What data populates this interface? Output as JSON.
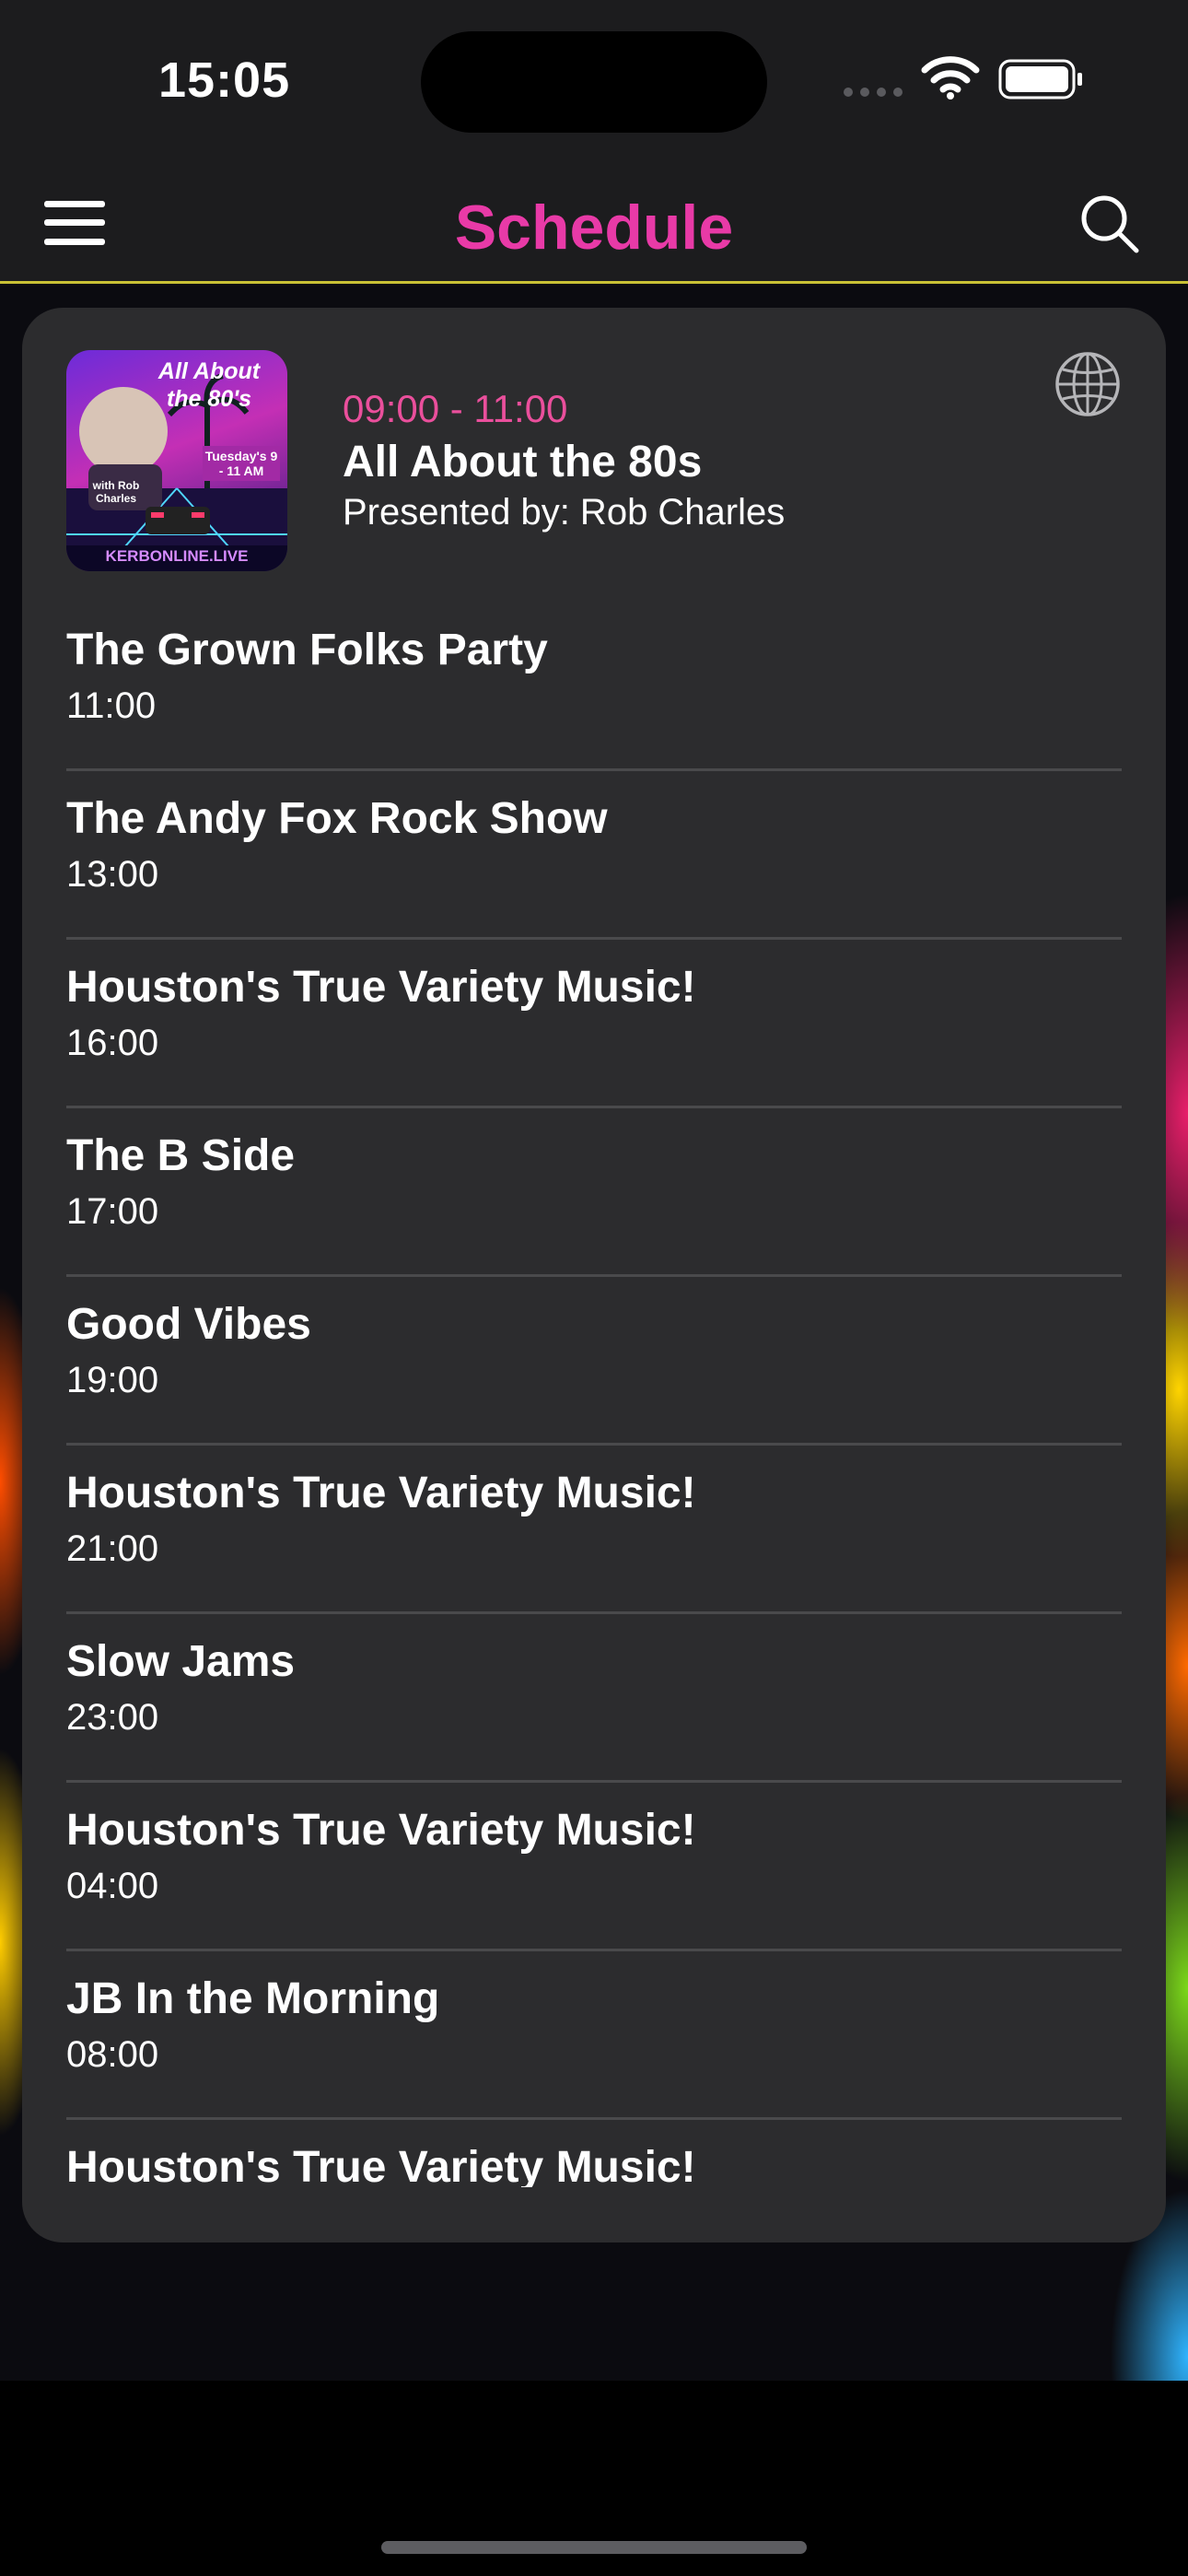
{
  "status_bar": {
    "time": "15:05"
  },
  "nav": {
    "title": "Schedule",
    "title_color": "#e83aa7",
    "menu_icon": "hamburger-menu-icon",
    "search_icon": "search-icon"
  },
  "now_playing": {
    "time_range": "09:00 - 11:00",
    "title": "All About the 80s",
    "presenter": "Presented by: Rob Charles",
    "artwork": {
      "title": "All About the 80's",
      "day": "Tuesday's 9 - 11 AM",
      "host": "with Rob Charles",
      "brand": "KERBONLINE.LIVE"
    },
    "globe_icon": "globe-icon"
  },
  "schedule": [
    {
      "title": "The Grown Folks Party",
      "time": "11:00"
    },
    {
      "title": "The Andy Fox Rock Show",
      "time": "13:00"
    },
    {
      "title": "Houston's True Variety Music!",
      "time": "16:00"
    },
    {
      "title": "The B Side",
      "time": "17:00"
    },
    {
      "title": "Good Vibes",
      "time": "19:00"
    },
    {
      "title": "Houston's True Variety Music!",
      "time": "21:00"
    },
    {
      "title": "Slow Jams",
      "time": "23:00"
    },
    {
      "title": "Houston's True Variety Music!",
      "time": "04:00"
    },
    {
      "title": "JB In the Morning",
      "time": "08:00"
    },
    {
      "title": "Houston's True Variety Music!",
      "time": ""
    }
  ]
}
